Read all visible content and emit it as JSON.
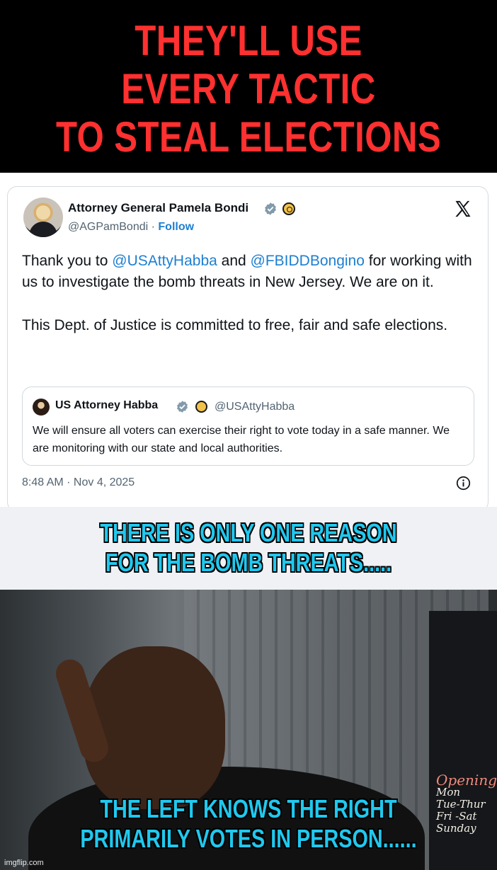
{
  "headline": {
    "lines": [
      "THEY'LL USE",
      "EVERY TACTIC",
      "TO STEAL ELECTIONS"
    ]
  },
  "tweet": {
    "author_name": "Attorney General Pamela Bondi",
    "handle": "@AGPamBondi",
    "separator": " · ",
    "follow_label": "Follow",
    "text": {
      "p1_a": "Thank you to ",
      "mention1": "@USAttyHabba",
      "p1_b": " and ",
      "mention2": "@FBIDDBongino",
      "p1_c": " for working with us to investigate the bomb threats in New Jersey. We are on it.",
      "p2": "This Dept. of Justice is committed to free, fair and safe elections."
    },
    "quote": {
      "author_name": "US Attorney Habba",
      "handle": "@USAttyHabba",
      "text": "We will ensure all voters can exercise their right to vote today in a safe manner. We are monitoring with our state and local authorities."
    },
    "timestamp": "8:48 AM · Nov 4, 2025",
    "icons": {
      "verified": "verified-badge-icon",
      "seal": "government-seal-icon",
      "platform": "x-logo-icon",
      "info": "info-icon"
    },
    "colors": {
      "link": "#1d7fd1",
      "verified": "#829aab",
      "text": "#0f1419",
      "muted": "#536471"
    }
  },
  "captions": {
    "top": [
      "THERE IS ONLY ONE REASON",
      "FOR THE BOMB THREATS....."
    ],
    "bottom": [
      "THE LEFT KNOWS THE RIGHT",
      "PRIMARILY VOTES IN PERSON......"
    ],
    "color": "#20c8ee"
  },
  "photo_sign": {
    "title": "Opening",
    "lines": [
      "Mon",
      "Tue-Thur",
      "Fri -Sat",
      "Sunday"
    ]
  },
  "watermark": "imgflip.com",
  "headline_color": "#ff3030"
}
